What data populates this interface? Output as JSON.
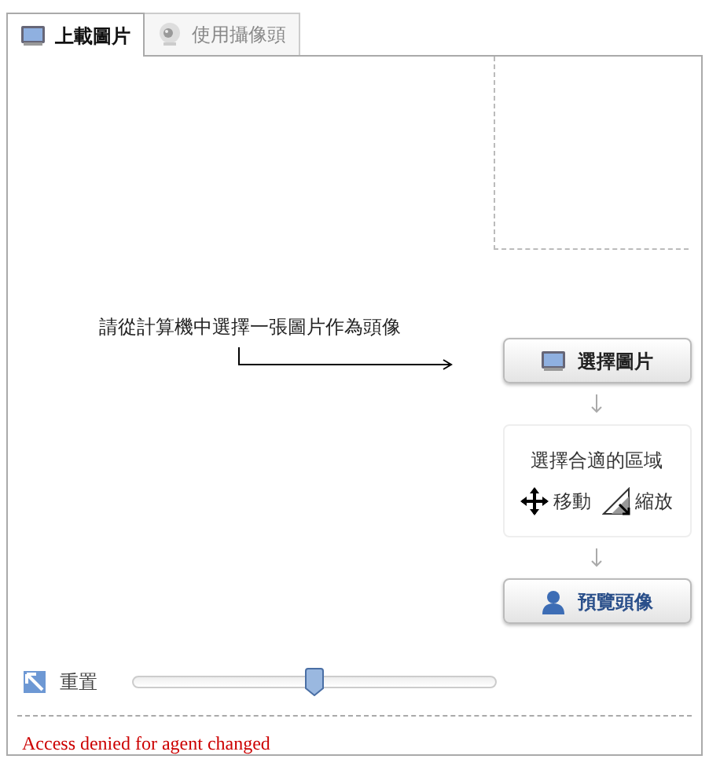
{
  "tabs": [
    {
      "label": "上載圖片",
      "selected": true
    },
    {
      "label": "使用攝像頭",
      "selected": false
    }
  ],
  "instruction": "請從計算機中選擇一張圖片作為頭像",
  "select_button": "選擇圖片",
  "area_box": {
    "title": "選擇合適的區域",
    "move": "移動",
    "zoom": "縮放"
  },
  "preview_button": "預覽頭像",
  "reset": "重置",
  "zoom_slider": {
    "level": 0.5
  },
  "error": "Access denied for agent changed"
}
